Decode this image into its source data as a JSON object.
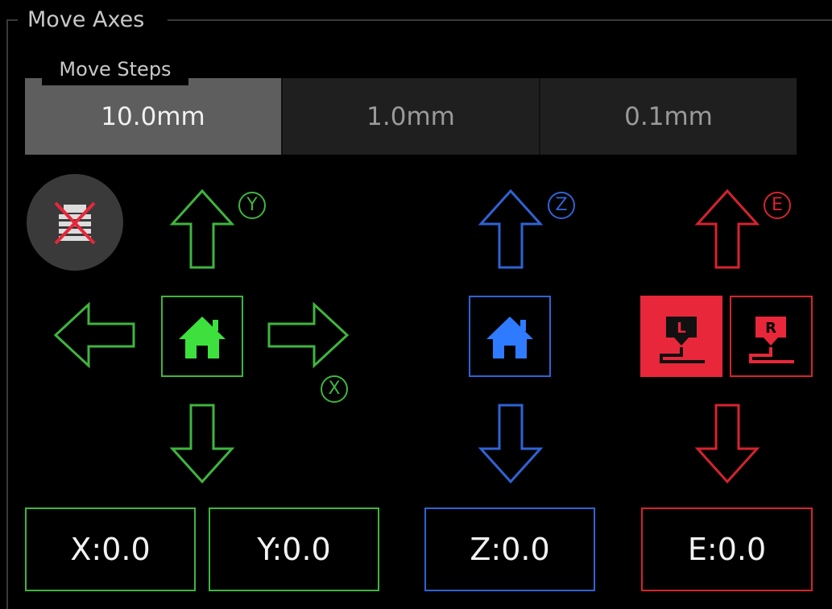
{
  "group": {
    "title": "Move Axes"
  },
  "steps": {
    "label": "Move Steps",
    "options": [
      "10.0mm",
      "1.0mm",
      "0.1mm"
    ],
    "selected": "10.0mm"
  },
  "axes": {
    "x": {
      "letter": "X",
      "color": "#3fb53f"
    },
    "y": {
      "letter": "Y",
      "color": "#3fb53f"
    },
    "z": {
      "letter": "Z",
      "color": "#2f63d4"
    },
    "e": {
      "letter": "E",
      "color": "#d6232f"
    }
  },
  "positions": {
    "x": "X:0.0",
    "y": "Y:0.0",
    "z": "Z:0.0",
    "e": "E:0.0"
  },
  "extruders": {
    "left_letter": "L",
    "right_letter": "R",
    "active": "left"
  },
  "icons": {
    "motor_off": "motor-off-icon",
    "home_xy": "home-icon",
    "home_z": "home-icon",
    "arrows": "arrow-icon"
  },
  "colors": {
    "background": "#000000",
    "xy": "#3fb53f",
    "z": "#2f63d4",
    "e": "#d6232f",
    "step_active": "#5e5e5e",
    "step_inactive": "#1f1f1f"
  }
}
